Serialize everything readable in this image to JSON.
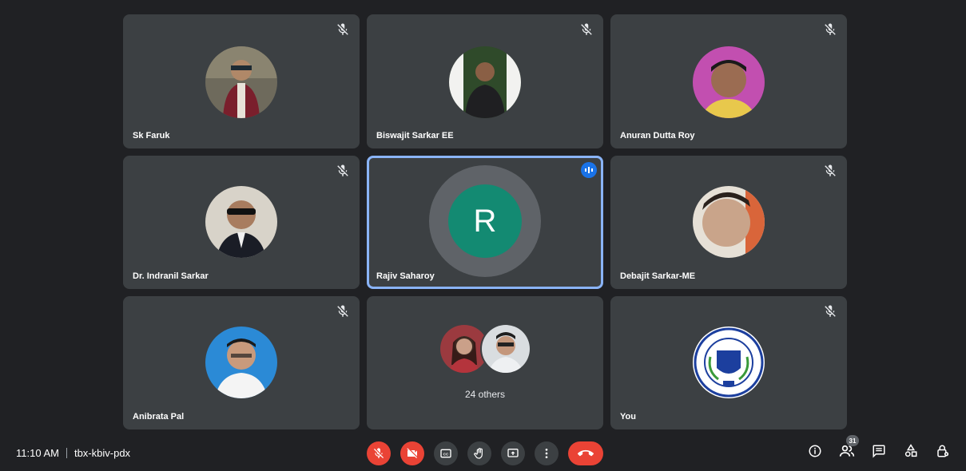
{
  "participants": [
    {
      "name": "Sk Faruk",
      "muted": true
    },
    {
      "name": "Biswajit Sarkar EE",
      "muted": true
    },
    {
      "name": "Anuran Dutta Roy",
      "muted": true
    },
    {
      "name": "Dr. Indranil Sarkar",
      "muted": true
    },
    {
      "name": "Rajiv Saharoy",
      "initial": "R",
      "speaking": true
    },
    {
      "name": "Debajit Sarkar-ME",
      "muted": true
    },
    {
      "name": "Anibrata Pal",
      "muted": true
    },
    {
      "others_label": "24 others"
    },
    {
      "name": "You",
      "muted": true
    }
  ],
  "bottombar": {
    "time": "11:10 AM",
    "meeting_code": "tbx-kbiv-pdx",
    "people_count": "31"
  },
  "colors": {
    "background": "#202124",
    "tile": "#3c4043",
    "danger": "#ea4335",
    "active_outline": "#8ab4f8",
    "avatar_letter_bg": "#138a72"
  },
  "icons": [
    "mic-off-icon",
    "video-off-icon",
    "captions-icon",
    "raise-hand-icon",
    "present-icon",
    "more-options-icon",
    "end-call-icon",
    "info-icon",
    "people-icon",
    "chat-icon",
    "activities-icon",
    "host-controls-icon"
  ]
}
